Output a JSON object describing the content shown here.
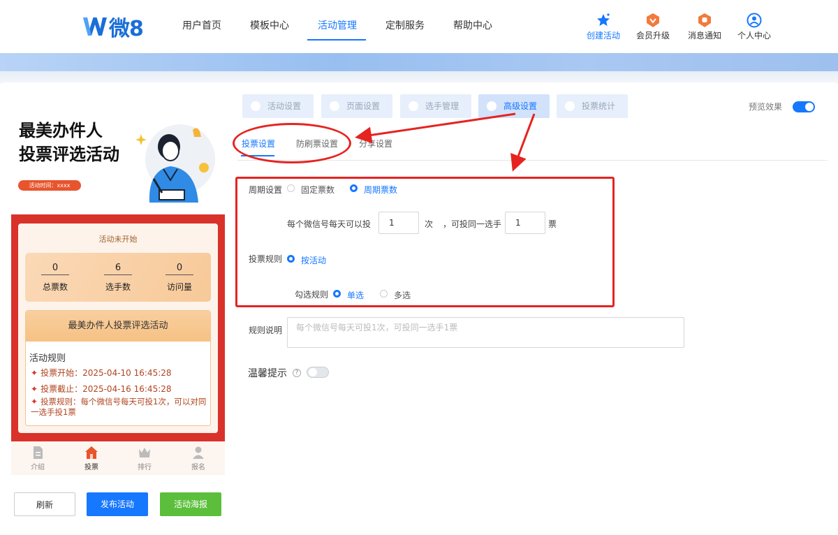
{
  "brand": {
    "logo_text": "微8",
    "accent": "#1677ff"
  },
  "nav": {
    "items": [
      "用户首页",
      "模板中心",
      "活动管理",
      "定制服务",
      "帮助中心"
    ],
    "active": "活动管理",
    "tools": [
      {
        "label": "创建活动",
        "icon": "star-icon"
      },
      {
        "label": "会员升级",
        "icon": "vip-badge-icon"
      },
      {
        "label": "消息通知",
        "icon": "bell-badge-icon"
      },
      {
        "label": "个人中心",
        "icon": "user-circle-icon"
      }
    ]
  },
  "preview": {
    "title_line1": "最美办件人",
    "title_line2": "投票评选活动",
    "time_pill": "活动时间：xxxx",
    "status": "活动未开始",
    "stats": [
      {
        "value": "0",
        "label": "总票数"
      },
      {
        "value": "6",
        "label": "选手数"
      },
      {
        "value": "0",
        "label": "访问量"
      }
    ],
    "activity_name": "最美办件人投票评选活动",
    "rules_title": "活动规则",
    "rules": [
      "投票开始：2025-04-10 16:45:28",
      "投票截止：2025-04-16 16:45:28",
      "投票规则：每个微信号每天可投1次，可以对同一选手投1票"
    ],
    "bottom_tabs": [
      "介绍",
      "投票",
      "排行",
      "报名"
    ],
    "active_tab": "投票",
    "buttons": {
      "refresh": "刷新",
      "publish": "发布活动",
      "poster": "活动海报"
    }
  },
  "settings": {
    "tabs": [
      "活动设置",
      "页面设置",
      "选手管理",
      "高级设置",
      "投票统计"
    ],
    "active_tab": "高级设置",
    "preview_label": "预览效果",
    "preview_on": true,
    "subtabs": [
      "投票设置",
      "防刷票设置",
      "分享设置"
    ],
    "active_subtab": "投票设置",
    "cycle": {
      "label": "周期设置",
      "options": [
        "固定票数",
        "周期票数"
      ],
      "selected": "周期票数",
      "daily_prefix": "每个微信号每天可以投",
      "daily_value": "1",
      "daily_unit": "次",
      "same_prefix": "，可投同一选手",
      "same_value": "1",
      "same_unit": "票"
    },
    "vote_rule": {
      "label": "投票规则",
      "option": "按活动"
    },
    "select_rule": {
      "label": "勾选规则",
      "options": [
        "单选",
        "多选"
      ],
      "selected": "单选"
    },
    "rule_desc": {
      "label": "规则说明",
      "placeholder": "每个微信号每天可投1次，可投同一选手1票"
    },
    "tip": {
      "label": "温馨提示",
      "help": "?",
      "on": false
    }
  }
}
